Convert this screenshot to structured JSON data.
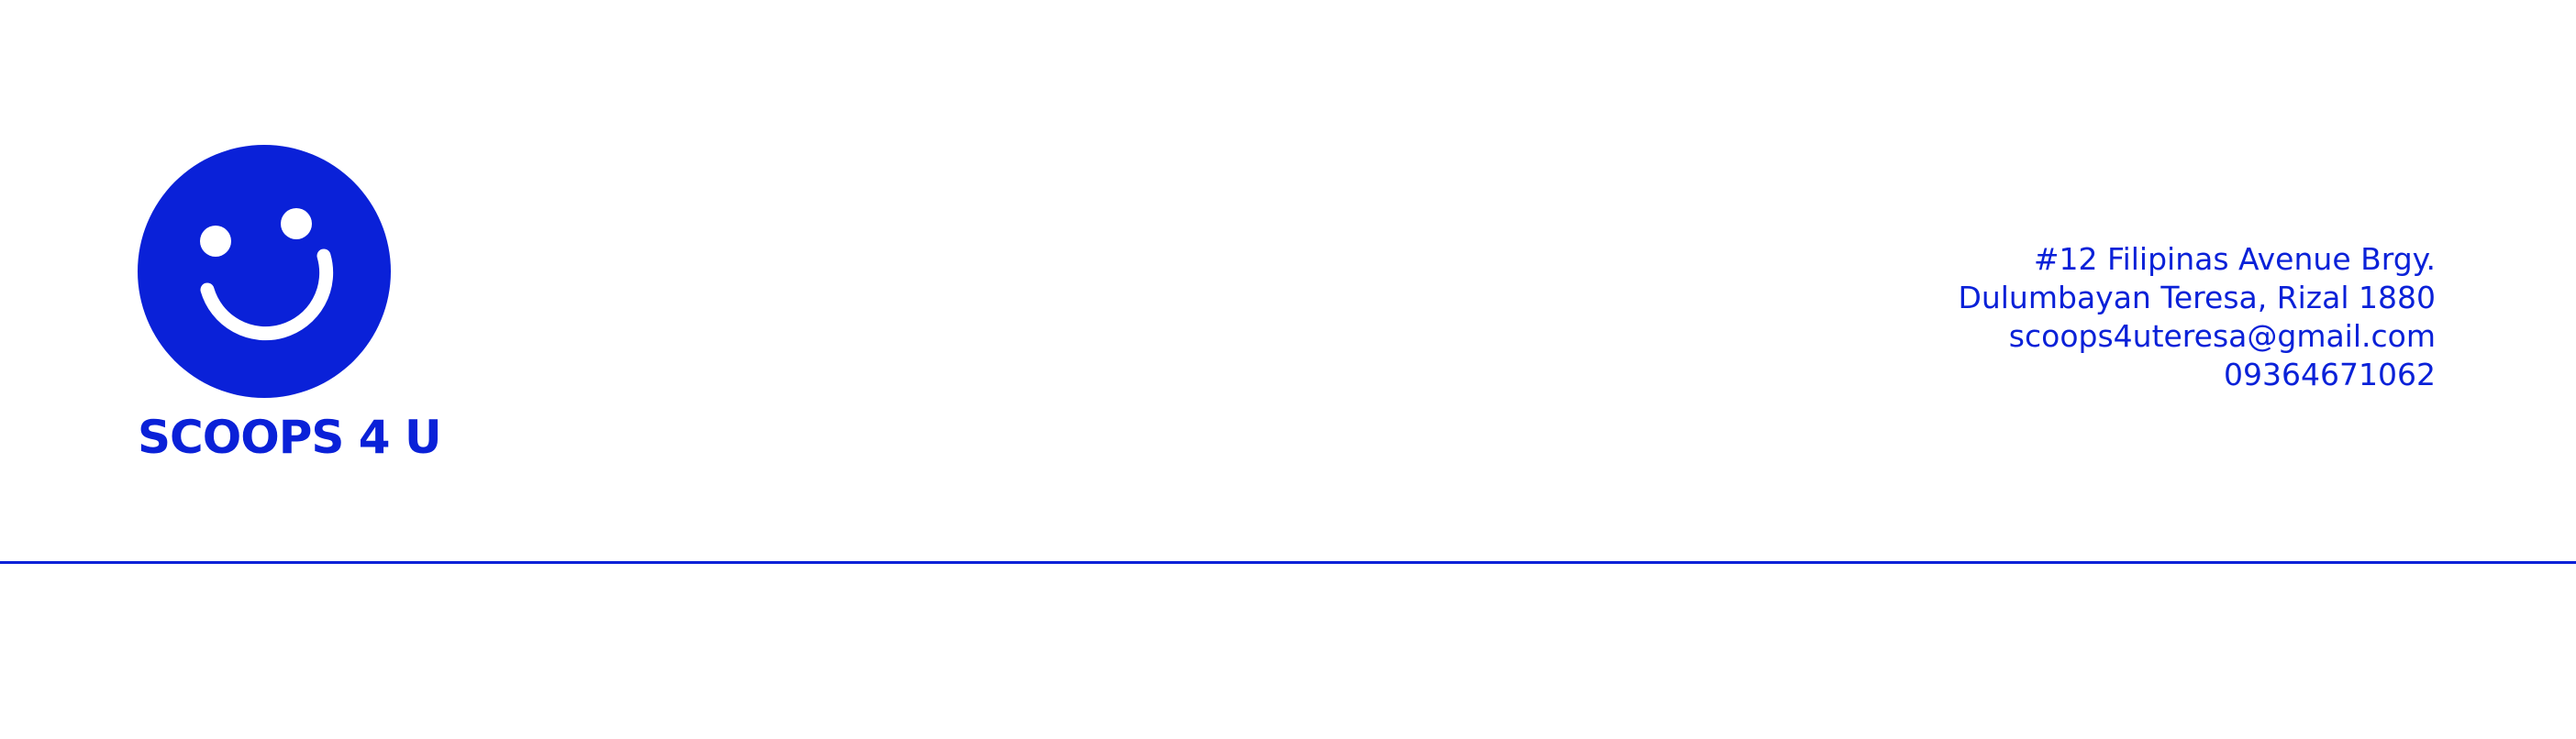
{
  "colors": {
    "brand": "#0A21D8",
    "background": "#FFFFFF",
    "logo_face_features": "#FFFFFF"
  },
  "logo": {
    "icon": "smiley-face-icon"
  },
  "brand": {
    "name": "SCOOPS 4 U"
  },
  "contact": {
    "address_line_1": "#12 Filipinas Avenue Brgy.",
    "address_line_2": "Dulumbayan Teresa, Rizal 1880",
    "email": "scoops4uteresa@gmail.com",
    "phone": "09364671062"
  }
}
